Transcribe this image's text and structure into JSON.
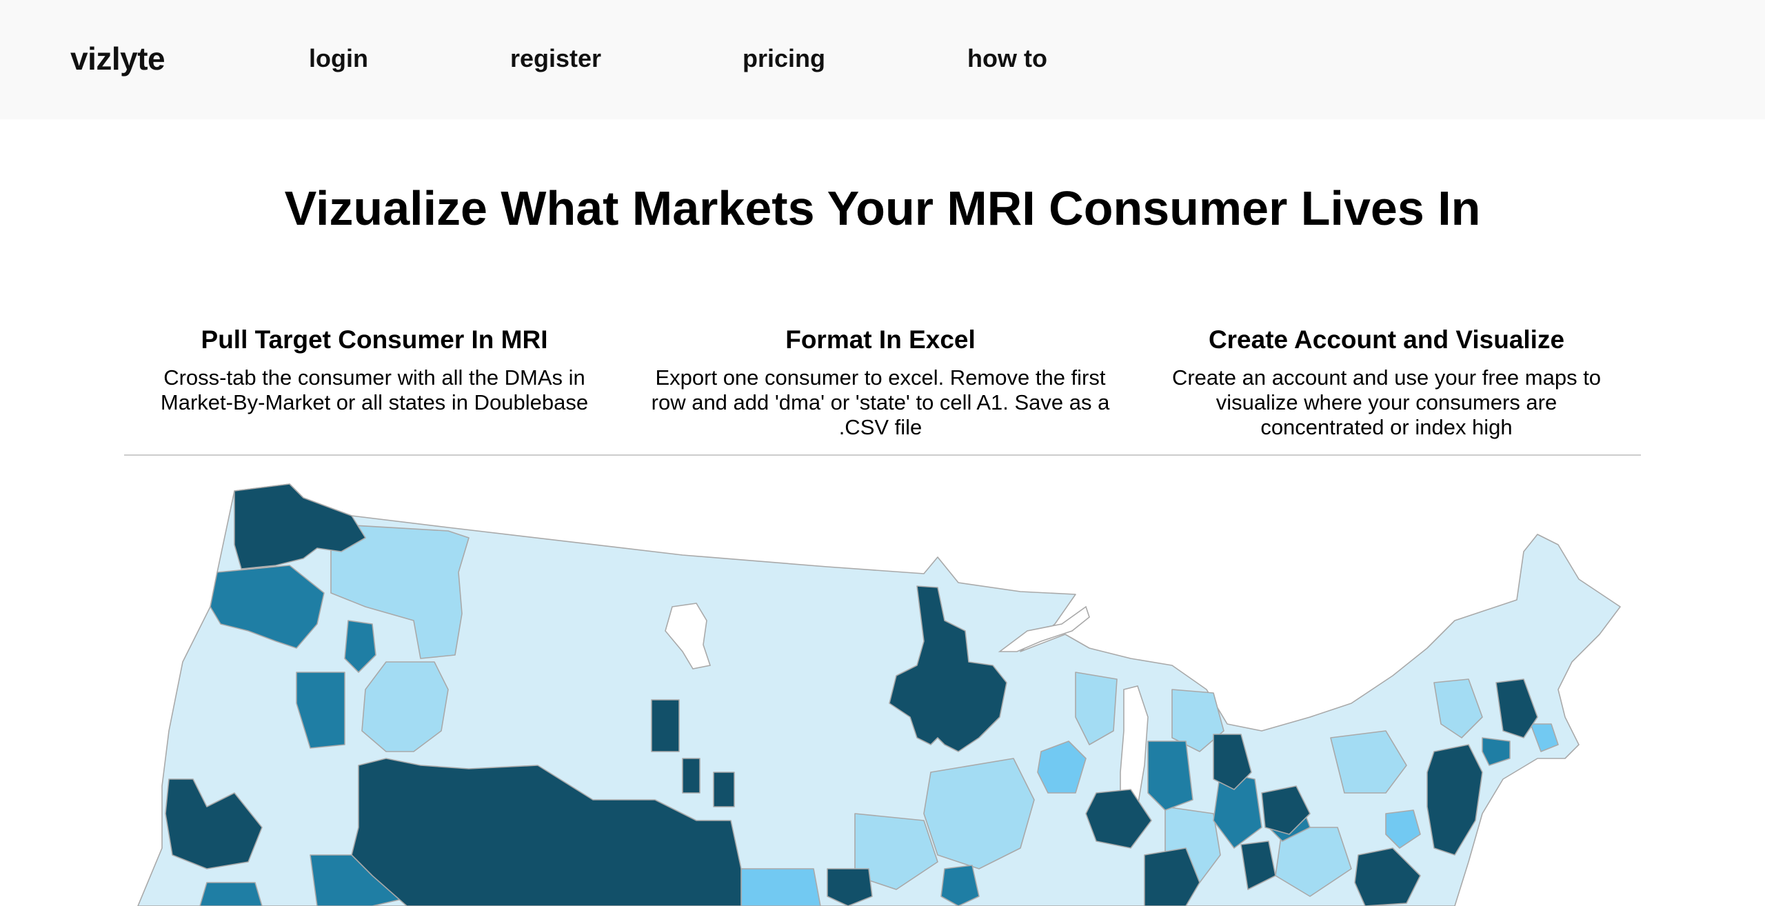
{
  "nav": {
    "brand": "vizlyte",
    "links": [
      "login",
      "register",
      "pricing",
      "how to"
    ]
  },
  "hero": {
    "title": "Vizualize What Markets Your MRI Consumer Lives In"
  },
  "steps": [
    {
      "title": "Pull Target Consumer In MRI",
      "body": "Cross-tab the consumer with all the DMAs in Market-By-Market or all states in Doublebase"
    },
    {
      "title": "Format In Excel",
      "body": "Export one consumer to excel. Remove the first row and add 'dma' or 'state' to cell A1. Save as a .CSV file"
    },
    {
      "title": "Create Account and Visualize",
      "body": "Create an account and use your free maps to visualize where your consumers are concentrated or index high"
    }
  ],
  "map": {
    "colors": {
      "lightest": "#d4edf8",
      "light": "#a3dcf3",
      "bright": "#72c9f2",
      "medium": "#1f7ea4",
      "dark": "#125069",
      "white": "#ffffff",
      "border": "#a9a9a9"
    }
  }
}
